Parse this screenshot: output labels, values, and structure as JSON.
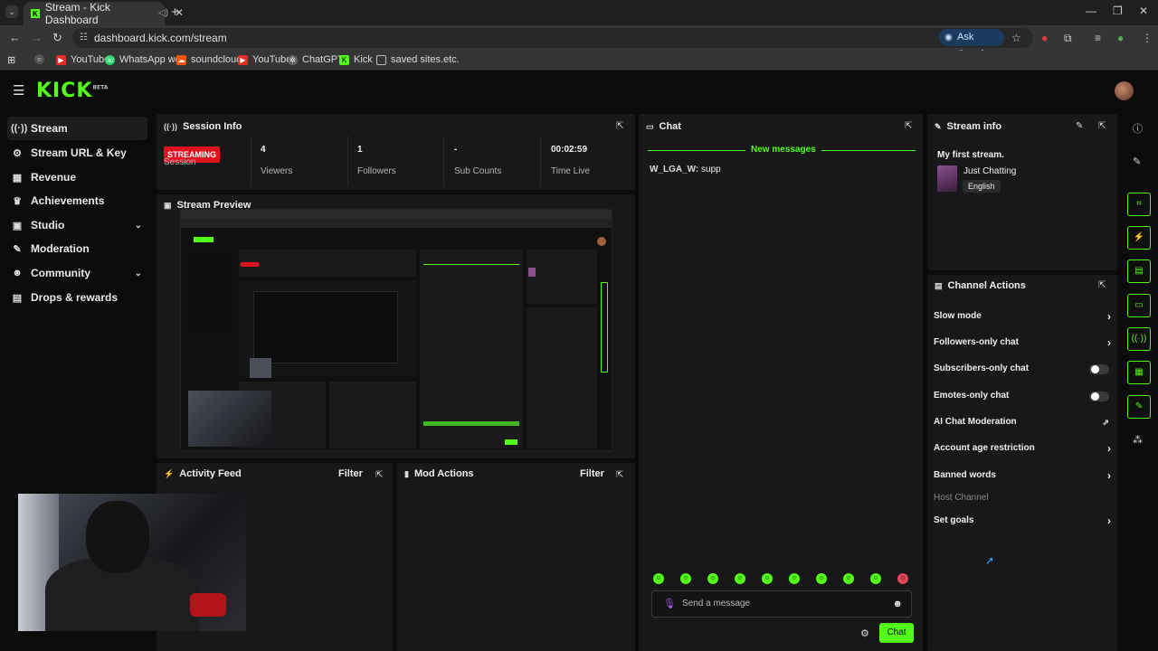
{
  "browser": {
    "tab_title": "Stream - Kick Dashboard",
    "url": "dashboard.kick.com/stream",
    "ask_google": "Ask Google",
    "bookmarks": [
      "YouTube",
      "WhatsApp web",
      "soundcloud",
      "YouTube",
      "ChatGPT",
      "Kick",
      "saved sites.etc."
    ]
  },
  "app": {
    "logo": "KICK",
    "logo_tag": "BETA"
  },
  "sidebar": {
    "items": [
      {
        "label": "Stream",
        "icon": "stream-icon"
      },
      {
        "label": "Stream URL & Key",
        "icon": "link-icon"
      },
      {
        "label": "Revenue",
        "icon": "revenue-icon"
      },
      {
        "label": "Achievements",
        "icon": "trophy-icon"
      },
      {
        "label": "Studio",
        "icon": "studio-icon"
      },
      {
        "label": "Moderation",
        "icon": "wrench-icon"
      },
      {
        "label": "Community",
        "icon": "people-icon"
      },
      {
        "label": "Drops & rewards",
        "icon": "drops-icon"
      }
    ]
  },
  "session": {
    "title": "Session Info",
    "badge": "STREAMING",
    "stats": [
      {
        "value": "",
        "label": "Session"
      },
      {
        "value": "4",
        "label": "Viewers"
      },
      {
        "value": "1",
        "label": "Followers"
      },
      {
        "value": "-",
        "label": "Sub Counts"
      },
      {
        "value": "00:02:59",
        "label": "Time Live"
      }
    ]
  },
  "preview": {
    "title": "Stream Preview"
  },
  "activity": {
    "title": "Activity Feed",
    "filter": "Filter"
  },
  "mod_actions": {
    "title": "Mod Actions",
    "filter": "Filter"
  },
  "chat": {
    "title": "Chat",
    "new_messages": "New messages",
    "messages": [
      {
        "user": "W_LGA_W:",
        "text": "supp"
      }
    ],
    "placeholder": "Send a message",
    "send_label": "Chat"
  },
  "stream_info": {
    "title": "Stream info",
    "stream_title": "My first stream.",
    "category": "Just Chatting",
    "language": "English"
  },
  "channel_actions": {
    "title": "Channel Actions",
    "rows": [
      {
        "label": "Slow mode",
        "control": "arrow"
      },
      {
        "label": "Followers-only chat",
        "control": "arrow"
      },
      {
        "label": "Subscribers-only chat",
        "control": "toggle"
      },
      {
        "label": "Emotes-only chat",
        "control": "toggle"
      },
      {
        "label": "AI Chat Moderation",
        "control": "external"
      },
      {
        "label": "Account age restriction",
        "control": "arrow"
      },
      {
        "label": "Banned words",
        "control": "arrow"
      },
      {
        "label": "Host Channel",
        "control": "none"
      },
      {
        "label": "Set goals",
        "control": "arrow"
      }
    ]
  },
  "colors": {
    "accent": "#53fc18",
    "live": "#e0121f",
    "panel": "#18181a",
    "background": "#0b0b0c"
  }
}
